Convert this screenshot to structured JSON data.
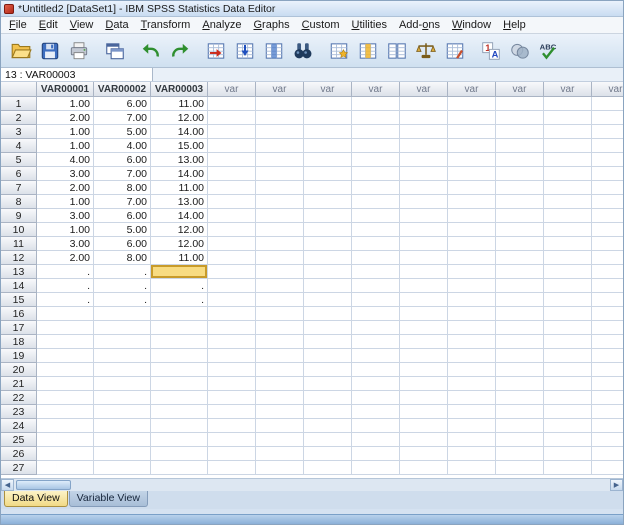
{
  "window": {
    "title": "*Untitled2 [DataSet1] - IBM SPSS Statistics Data Editor"
  },
  "menu": {
    "items": [
      {
        "label": "File",
        "accel": 0
      },
      {
        "label": "Edit",
        "accel": 0
      },
      {
        "label": "View",
        "accel": 0
      },
      {
        "label": "Data",
        "accel": 0
      },
      {
        "label": "Transform",
        "accel": 0
      },
      {
        "label": "Analyze",
        "accel": 0
      },
      {
        "label": "Graphs",
        "accel": 0
      },
      {
        "label": "Custom",
        "accel": 0
      },
      {
        "label": "Utilities",
        "accel": 0
      },
      {
        "label": "Add-ons",
        "accel": 4
      },
      {
        "label": "Window",
        "accel": 0
      },
      {
        "label": "Help",
        "accel": 0
      }
    ]
  },
  "toolbar": {
    "icons": [
      {
        "name": "open-data"
      },
      {
        "name": "save"
      },
      {
        "name": "print"
      },
      {
        "name": "recall-dialogs"
      },
      {
        "name": "undo"
      },
      {
        "name": "redo"
      },
      {
        "name": "goto-case"
      },
      {
        "name": "goto-variable"
      },
      {
        "name": "variables"
      },
      {
        "name": "find"
      },
      {
        "name": "insert-cases"
      },
      {
        "name": "insert-variable"
      },
      {
        "name": "split-file"
      },
      {
        "name": "weight-cases"
      },
      {
        "name": "select-cases"
      },
      {
        "name": "value-labels"
      },
      {
        "name": "use-sets"
      },
      {
        "name": "spell-check"
      }
    ]
  },
  "cell_reference": "13 : VAR00003",
  "grid": {
    "named_columns": [
      "VAR00001",
      "VAR00002",
      "VAR00003"
    ],
    "var_column_label": "var",
    "var_column_count": 9,
    "visible_rows": 27,
    "selected": {
      "row": 13,
      "column": "VAR00003",
      "col_index": 2
    },
    "rows": [
      {
        "n": 1,
        "values": [
          "1.00",
          "6.00",
          "11.00"
        ]
      },
      {
        "n": 2,
        "values": [
          "2.00",
          "7.00",
          "12.00"
        ]
      },
      {
        "n": 3,
        "values": [
          "1.00",
          "5.00",
          "14.00"
        ]
      },
      {
        "n": 4,
        "values": [
          "1.00",
          "4.00",
          "15.00"
        ]
      },
      {
        "n": 5,
        "values": [
          "4.00",
          "6.00",
          "13.00"
        ]
      },
      {
        "n": 6,
        "values": [
          "3.00",
          "7.00",
          "14.00"
        ]
      },
      {
        "n": 7,
        "values": [
          "2.00",
          "8.00",
          "11.00"
        ]
      },
      {
        "n": 8,
        "values": [
          "1.00",
          "7.00",
          "13.00"
        ]
      },
      {
        "n": 9,
        "values": [
          "3.00",
          "6.00",
          "14.00"
        ]
      },
      {
        "n": 10,
        "values": [
          "1.00",
          "5.00",
          "12.00"
        ]
      },
      {
        "n": 11,
        "values": [
          "3.00",
          "6.00",
          "12.00"
        ]
      },
      {
        "n": 12,
        "values": [
          "2.00",
          "8.00",
          "11.00"
        ]
      },
      {
        "n": 13,
        "values": [
          ".",
          ".",
          ""
        ]
      },
      {
        "n": 14,
        "values": [
          ".",
          ".",
          "."
        ]
      },
      {
        "n": 15,
        "values": [
          ".",
          ".",
          "."
        ]
      }
    ]
  },
  "scrollbar": {
    "left_arrow": "◀",
    "right_arrow": "▶"
  },
  "tabs": [
    {
      "label": "Data View",
      "active": true
    },
    {
      "label": "Variable View",
      "active": false
    }
  ],
  "colors": {
    "selected_cell_bg": "#f8dc82",
    "selected_cell_border": "#c89b2a",
    "active_tab_bg": "#f1da86",
    "toolbar_bg": "#d8e6f3",
    "status_strip": "#9cbade"
  }
}
